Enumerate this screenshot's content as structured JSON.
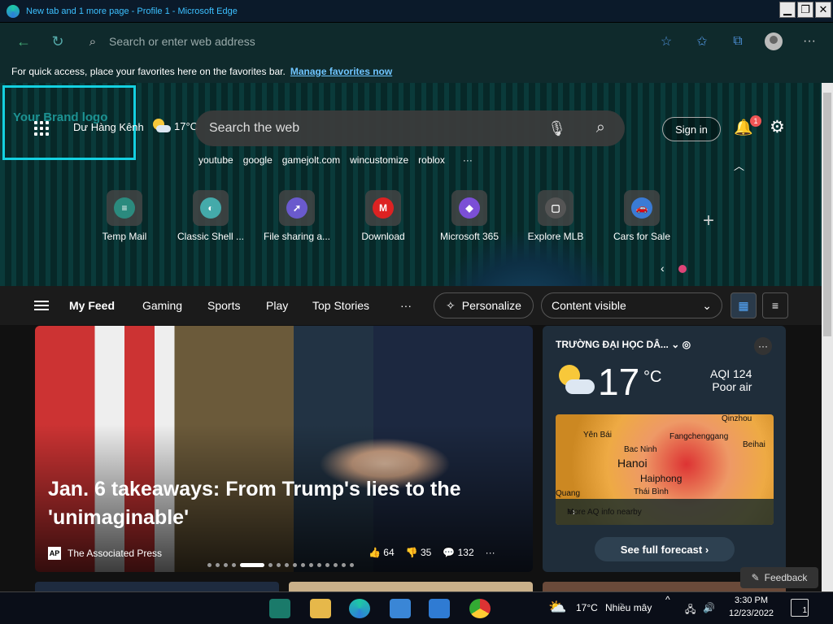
{
  "window": {
    "title": "New tab and 1 more page - Profile 1 - Microsoft Edge"
  },
  "address": {
    "placeholder": "Search or enter web address"
  },
  "favorites_bar": {
    "text": "For quick access, place your favorites here on the favorites bar.",
    "link": "Manage favorites now"
  },
  "hero": {
    "brand_logo": "Your Brand logo",
    "location": "Dư Hàng Kênh",
    "temp": "17°C",
    "search_placeholder": "Search the web",
    "sign_in": "Sign in",
    "notif_count": "1",
    "quicklinks": [
      "youtube",
      "google",
      "gamejolt.com",
      "wincustomize",
      "roblox"
    ],
    "more": "···",
    "tiles": [
      {
        "label": "Temp Mail",
        "icon": "temp-mail-icon",
        "color": "#2b8a7e",
        "glyph": "≡"
      },
      {
        "label": "Classic Shell ...",
        "icon": "classic-shell-icon",
        "color": "#4aa",
        "glyph": "◐"
      },
      {
        "label": "File sharing a...",
        "icon": "file-sharing-icon",
        "color": "#6a5acd",
        "glyph": "➚"
      },
      {
        "label": "Download",
        "icon": "download-icon",
        "color": "#d22",
        "glyph": "M"
      },
      {
        "label": "Microsoft 365",
        "icon": "microsoft365-icon",
        "color": "#7b4fd6",
        "glyph": "◆"
      },
      {
        "label": "Explore MLB",
        "icon": "mlb-icon",
        "color": "#555",
        "glyph": "▢"
      },
      {
        "label": "Cars for Sale",
        "icon": "cars-icon",
        "color": "#3a7bd5",
        "glyph": "🚗"
      }
    ]
  },
  "feed": {
    "tabs": [
      "My Feed",
      "Gaming",
      "Sports",
      "Play",
      "Top Stories"
    ],
    "more": "···",
    "personalize": "Personalize",
    "content_visible": "Content visible"
  },
  "story": {
    "headline": "Jan. 6 takeaways: From Trump's lies to the 'unimaginable'",
    "source": "The Associated Press",
    "source_logo": "AP",
    "likes": "64",
    "dislikes": "35",
    "comments": "132",
    "dots": 16,
    "active_dot": 4
  },
  "weather": {
    "location": "TRƯỜNG ĐẠI HỌC DÂ...",
    "temp": "17",
    "unit": "°C",
    "aqi": "AQI 124",
    "aqi_label": "Poor air",
    "map_labels": [
      "Qinzhou",
      "Yên Bái",
      "Fangchenggang",
      "Bac Ninh",
      "Beihai",
      "Hanoi",
      "Haiphong",
      "Thái Bình",
      "Quang"
    ],
    "aq_link": "More AQ info nearby",
    "forecast_btn": "See full forecast"
  },
  "feedback": "Feedback",
  "taskbar": {
    "temp": "17°C",
    "weather": "Nhiều mây",
    "time": "3:30 PM",
    "date": "12/23/2022",
    "notif": "1"
  }
}
